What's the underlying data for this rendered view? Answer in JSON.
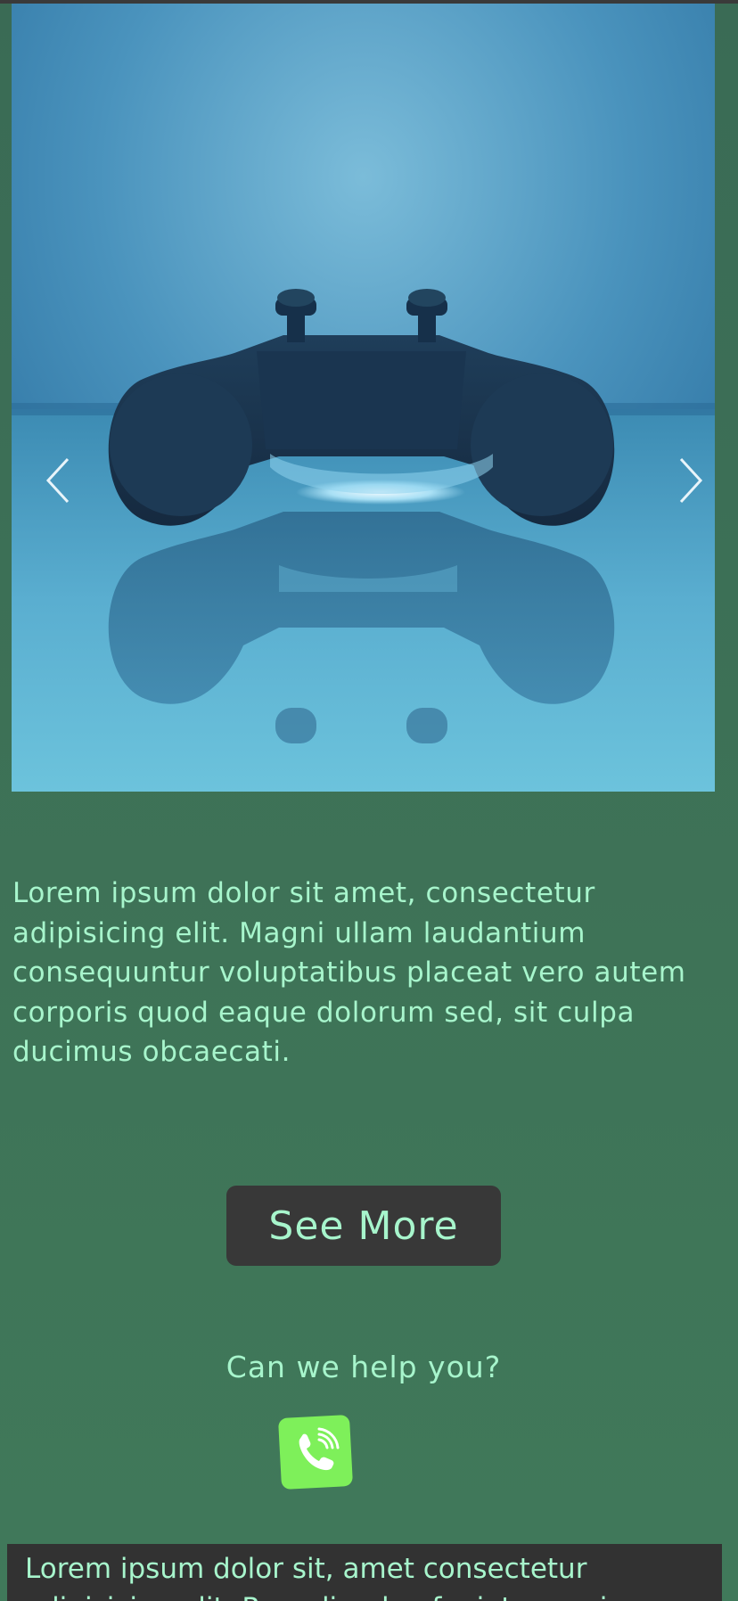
{
  "carousel": {
    "image_alt": "game controller",
    "prev_icon": "chevron-left-icon",
    "next_icon": "chevron-right-icon"
  },
  "main": {
    "intro_text": "Lorem ipsum dolor sit amet, consectetur adipisicing elit. Magni ullam laudantium consequuntur voluptatibus placeat vero autem corporis quod eaque dolorum sed, sit culpa ducimus obcaecati.",
    "see_more_label": "See More",
    "help_text": "Can we help you?",
    "phone_icon": "phone-icon"
  },
  "footer": {
    "text": "Lorem ipsum dolor sit, amet consectetur adipisicing elit. Repudiandae fugiat magni"
  },
  "colors": {
    "background": "#3d7157",
    "text_accent": "#a7f5cc",
    "button_bg": "#383838",
    "phone_green": "#7ef05a",
    "footer_bg": "#323232"
  }
}
